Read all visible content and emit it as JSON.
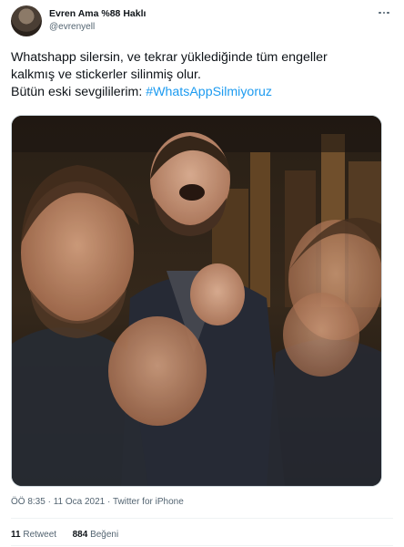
{
  "author": {
    "name": "Evren Ama %88 Haklı",
    "handle": "@evrenyell"
  },
  "tweet": {
    "line1": "Whatshapp silersin, ve tekrar yüklediğinde tüm engeller",
    "line2": "kalkmış ve stickerler silinmiş olur.",
    "line3_prefix": "Bütün eski sevgililerim: ",
    "hashtag": "#WhatsAppSilmiyoruz"
  },
  "media": {
    "alt": "Laughing man photo montage"
  },
  "meta": {
    "time": "ÖÖ 8:35",
    "separator1": " · ",
    "date": "11 Oca 2021",
    "separator2": " · ",
    "source": "Twitter for iPhone"
  },
  "stats": {
    "retweet_count": "11",
    "retweet_label": "Retweet",
    "like_count": "884",
    "like_label": "Beğeni"
  },
  "colors": {
    "link": "#1d9bf0",
    "text": "#0f1419",
    "secondary": "#536471"
  },
  "icons": {
    "more": "more-horizontal-icon"
  }
}
